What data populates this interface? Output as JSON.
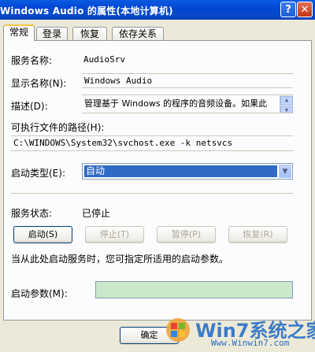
{
  "window": {
    "title": "Windows Audio 的属性(本地计算机)",
    "help_glyph": "?",
    "close_glyph": "✕"
  },
  "tabs": [
    {
      "label": "常规",
      "active": true
    },
    {
      "label": "登录",
      "active": false
    },
    {
      "label": "恢复",
      "active": false
    },
    {
      "label": "依存关系",
      "active": false
    }
  ],
  "general": {
    "service_name_label": "服务名称:",
    "service_name_value": "AudioSrv",
    "display_name_label": "显示名称(N):",
    "display_name_value": "Windows Audio",
    "description_label": "描述(D):",
    "description_value": "管理基于 Windows 的程序的音频设备。如果此",
    "exe_path_label": "可执行文件的路径(H):",
    "exe_path_value": "C:\\WINDOWS\\System32\\svchost.exe -k netsvcs",
    "startup_type_label": "启动类型(E):",
    "startup_type_value": "自动",
    "service_status_label": "服务状态:",
    "service_status_value": "已停止",
    "start_label": "启动(S)",
    "stop_label": "停止(T)",
    "pause_label": "暂停(P)",
    "resume_label": "恢复(R)",
    "hint_text": "当从此处启动服务时，您可指定所适用的启动参数。",
    "start_params_label": "启动参数(M):",
    "start_params_value": ""
  },
  "footer": {
    "ok_label": "确定"
  },
  "watermark": {
    "text": "Win7系统之家",
    "url": "Www.Winwin7.com"
  },
  "colors": {
    "titlebar": "#0A5BE0",
    "selection": "#316AC5",
    "param_field": "#CBE8CB",
    "dialog_bg": "#ECE9D8"
  }
}
